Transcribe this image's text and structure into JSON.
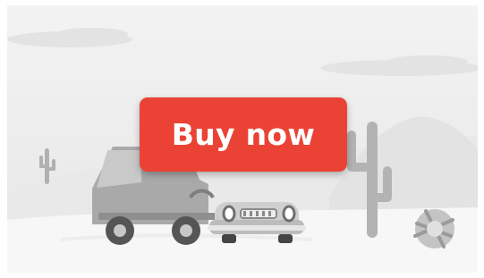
{
  "button": {
    "label": "Buy now",
    "color": "#ea4335",
    "text_color": "#ffffff"
  },
  "illustration": {
    "name": "desert-scene-with-car-and-cacti",
    "palette": [
      "#ececec",
      "#f7f7f7",
      "#d9d9d9",
      "#bdbdbd",
      "#9e9e9e",
      "#757575"
    ]
  }
}
